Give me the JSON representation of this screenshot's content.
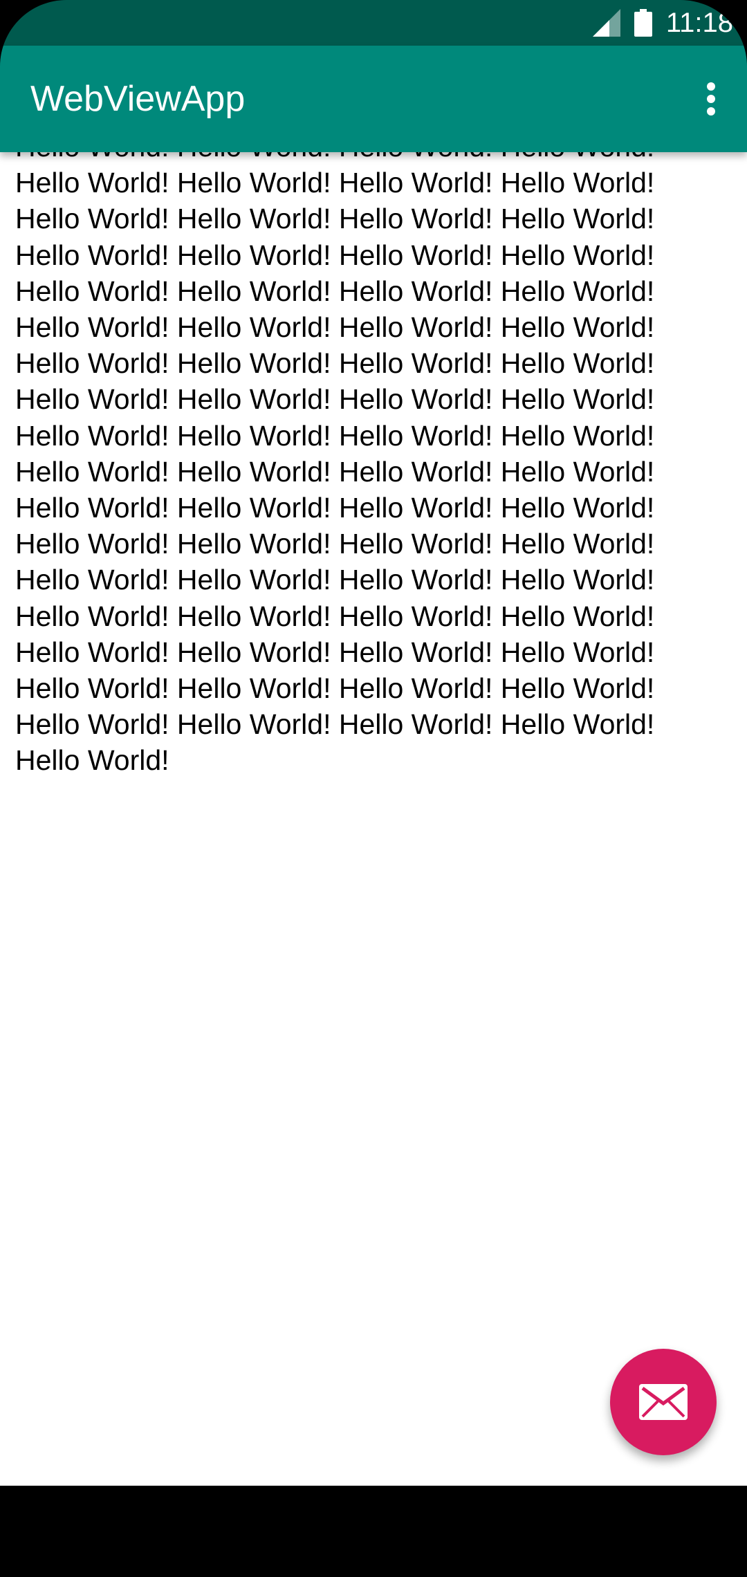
{
  "status_bar": {
    "time": "11:18",
    "icons": [
      "signal-icon",
      "battery-icon"
    ],
    "background": "#005A4E"
  },
  "app_bar": {
    "title": "WebViewApp",
    "menu_icon": "more-vert-icon",
    "background": "#00897B"
  },
  "web_content": {
    "text": "Hello World! Hello World! Hello World! Hello World! Hello World! Hello World! Hello World! Hello World! Hello World! Hello World! Hello World! Hello World! Hello World! Hello World! Hello World! Hello World! Hello World! Hello World! Hello World! Hello World! Hello World! Hello World! Hello World! Hello World! Hello World! Hello World! Hello World! Hello World! Hello World! Hello World! Hello World! Hello World! Hello World! Hello World! Hello World! Hello World! Hello World! Hello World! Hello World! Hello World! Hello World! Hello World! Hello World! Hello World! Hello World! Hello World! Hello World! Hello World! Hello World! Hello World! Hello World! Hello World! Hello World! Hello World! Hello World! Hello World! Hello World! Hello World! Hello World! Hello World! Hello World! Hello World! Hello World! Hello World! Hello World! Hello World! Hello World! Hello World! Hello World!"
  },
  "fab": {
    "icon": "mail-icon",
    "color": "#D81B60"
  }
}
